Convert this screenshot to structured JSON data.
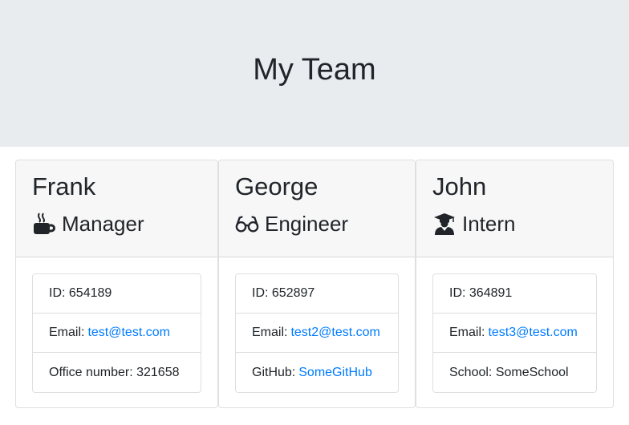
{
  "header": {
    "title": "My Team"
  },
  "colors": {
    "jumbotron_bg": "#e9ecef",
    "card_header_bg": "#f7f7f7",
    "link": "#007bff",
    "text": "#212529"
  },
  "cards": [
    {
      "name": "Frank",
      "role": "Manager",
      "icon": "coffee-mug-icon",
      "id_label": "ID:",
      "id_value": "654189",
      "email_label": "Email:",
      "email_value": "test@test.com",
      "extra_label": "Office number:",
      "extra_value": "321658"
    },
    {
      "name": "George",
      "role": "Engineer",
      "icon": "glasses-icon",
      "id_label": "ID:",
      "id_value": "652897",
      "email_label": "Email:",
      "email_value": "test2@test.com",
      "extra_label": "GitHub:",
      "extra_value": "SomeGitHub"
    },
    {
      "name": "John",
      "role": "Intern",
      "icon": "graduate-icon",
      "id_label": "ID:",
      "id_value": "364891",
      "email_label": "Email:",
      "email_value": "test3@test.com",
      "extra_label": "School:",
      "extra_value": "SomeSchool"
    }
  ]
}
